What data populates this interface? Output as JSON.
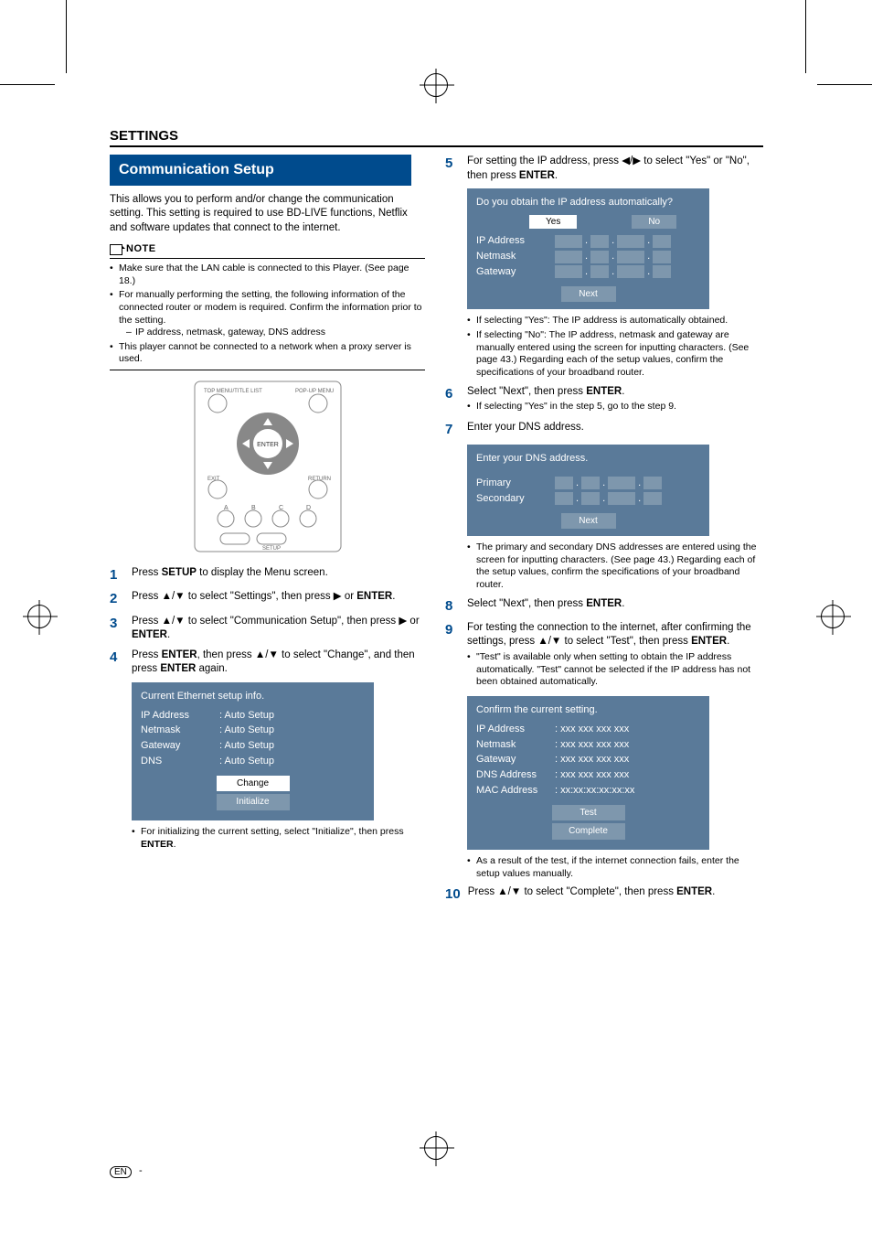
{
  "section_title": "SETTINGS",
  "banner": "Communication Setup",
  "intro": "This allows you to perform and/or change the communication setting. This setting is required to use BD-LIVE functions, Netflix and software updates that connect to the internet.",
  "note_label": "NOTE",
  "notes": [
    "Make sure that the LAN cable is connected to this Player. (See page 18.)",
    "For manually performing the setting, the following information of the connected router or modem is required. Confirm the information prior to the setting.",
    "This player cannot be connected to a network when a proxy server is used."
  ],
  "note_sub": "IP address, netmask, gateway, DNS address",
  "remote": {
    "top_left": "TOP MENU/TITLE LIST",
    "top_right": "POP-UP MENU",
    "enter": "ENTER",
    "exit": "EXIT",
    "return": "RETURN",
    "setup": "SETUP",
    "a": "A",
    "b": "B",
    "c": "C",
    "d": "D"
  },
  "steps_left": {
    "s1": {
      "num": "1",
      "body_pre": "Press ",
      "b1": "SETUP",
      "body_post": " to display the Menu screen."
    },
    "s2": {
      "num": "2",
      "body_pre": "Press ",
      "arrows": "▲/▼",
      "mid": " to select \"Settings\", then press ",
      "arrow2": "▶",
      "post": " or ",
      "b1": "ENTER",
      "end": "."
    },
    "s3": {
      "num": "3",
      "body_pre": "Press ",
      "arrows": "▲/▼",
      "mid": " to select \"Communication Setup\", then press ",
      "arrow2": "▶",
      "post": " or ",
      "b1": "ENTER",
      "end": "."
    },
    "s4": {
      "num": "4",
      "body_pre": "Press ",
      "b1": "ENTER",
      "mid": ", then press ",
      "arrows": "▲/▼",
      "mid2": " to select \"Change\", and then press ",
      "b2": "ENTER",
      "end": " again."
    }
  },
  "panel_ethernet": {
    "title": "Current Ethernet setup info.",
    "rows": [
      {
        "label": "IP Address",
        "val": ": Auto Setup"
      },
      {
        "label": "Netmask",
        "val": ": Auto Setup"
      },
      {
        "label": "Gateway",
        "val": ": Auto Setup"
      },
      {
        "label": "DNS",
        "val": ": Auto Setup"
      }
    ],
    "btn1": "Change",
    "btn2": "Initialize"
  },
  "left_footnote": {
    "pre": "For initializing the current setting, select \"Initialize\", then press ",
    "b": "ENTER",
    "post": "."
  },
  "steps_right": {
    "s5": {
      "num": "5",
      "pre": "For setting the IP address, press ",
      "arrows": "◀/▶",
      "mid": " to select \"Yes\" or \"No\", then press ",
      "b": "ENTER",
      "end": "."
    },
    "s6": {
      "num": "6",
      "pre": "Select \"Next\", then press ",
      "b": "ENTER",
      "end": "."
    },
    "s6_sub": "If selecting \"Yes\" in the step 5, go to the step 9.",
    "s7": {
      "num": "7",
      "body": "Enter your DNS address."
    },
    "s8": {
      "num": "8",
      "pre": "Select \"Next\", then press ",
      "b": "ENTER",
      "end": "."
    },
    "s9": {
      "num": "9",
      "pre": "For testing the connection to the internet, after confirming the settings, press ",
      "arrows": "▲/▼",
      "mid": " to select \"Test\", then press ",
      "b": "ENTER",
      "end": "."
    },
    "s9_sub": "\"Test\" is available only when setting to obtain the IP address automatically. \"Test\" cannot be selected if the IP address has not been obtained automatically.",
    "s10": {
      "num": "10",
      "pre": "Press ",
      "arrows": "▲/▼",
      "mid": " to select \"Complete\", then press ",
      "b": "ENTER",
      "end": "."
    }
  },
  "panel_ip": {
    "title": "Do you obtain the IP address automatically?",
    "yes": "Yes",
    "no": "No",
    "rows": [
      "IP Address",
      "Netmask",
      "Gateway"
    ],
    "next": "Next"
  },
  "ip_notes": [
    "If selecting \"Yes\": The IP address is automatically obtained.",
    "If selecting \"No\": The IP address, netmask and gateway are manually entered using the screen for inputting characters. (See page 43.) Regarding each of the setup values, confirm the specifications of your broadband router."
  ],
  "panel_dns": {
    "title": "Enter your DNS address.",
    "rows": [
      "Primary",
      "Secondary"
    ],
    "next": "Next"
  },
  "dns_note": "The primary and secondary DNS addresses are entered using the screen for inputting characters. (See page 43.) Regarding each of the setup values, confirm the specifications of your broadband router.",
  "panel_confirm": {
    "title": "Confirm the current setting.",
    "rows": [
      {
        "label": "IP Address",
        "val": ": xxx xxx xxx xxx"
      },
      {
        "label": "Netmask",
        "val": ": xxx xxx xxx xxx"
      },
      {
        "label": "Gateway",
        "val": ": xxx xxx xxx xxx"
      },
      {
        "label": "DNS Address",
        "val": ": xxx xxx xxx xxx"
      },
      {
        "label": "MAC Address",
        "val": ": xx:xx:xx:xx:xx:xx"
      }
    ],
    "btn1": "Test",
    "btn2": "Complete"
  },
  "confirm_note": "As a result of the test, if the internet connection fails, enter the setup values manually.",
  "footer_en": "EN",
  "footer_dash": "-"
}
